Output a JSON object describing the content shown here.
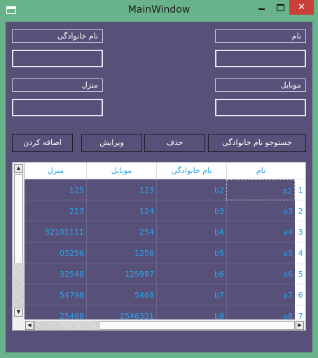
{
  "window": {
    "title": "MainWindow",
    "minimize_glyph": "",
    "maximize_glyph": "",
    "close_glyph": "✕"
  },
  "form": {
    "first_name_label": "نام",
    "last_name_label": "نام خانوادگی",
    "mobile_label": "موبایل",
    "home_label": "منزل",
    "first_name_value": "",
    "last_name_value": "",
    "mobile_value": "",
    "home_value": ""
  },
  "toolbar": {
    "search_label": "جستوجو نام خانوادگی",
    "delete_label": "حذف",
    "edit_label": "ویرایش",
    "add_label": "اضافه کردن"
  },
  "grid": {
    "columns": [
      "نام",
      "نام خانوادگی",
      "موبایل",
      "منزل"
    ],
    "rows": [
      {
        "num": "1",
        "name": "a2",
        "family": "b2",
        "mobile": "123",
        "home": "125"
      },
      {
        "num": "2",
        "name": "a3",
        "family": "b3",
        "mobile": "124",
        "home": "213"
      },
      {
        "num": "3",
        "name": "a4",
        "family": "b4",
        "mobile": "254",
        "home": "32101111"
      },
      {
        "num": "4",
        "name": "a5",
        "family": "b5",
        "mobile": "1256",
        "home": "03256"
      },
      {
        "num": "5",
        "name": "a6",
        "family": "b6",
        "mobile": "125987",
        "home": "32548"
      },
      {
        "num": "6",
        "name": "a7",
        "family": "b7",
        "mobile": "5468",
        "home": "54798"
      },
      {
        "num": "7",
        "name": "a8",
        "family": "b8",
        "mobile": "2546321",
        "home": "25468"
      }
    ]
  },
  "icons": {
    "up": "▲",
    "down": "▼",
    "left": "◀",
    "right": "▶"
  }
}
